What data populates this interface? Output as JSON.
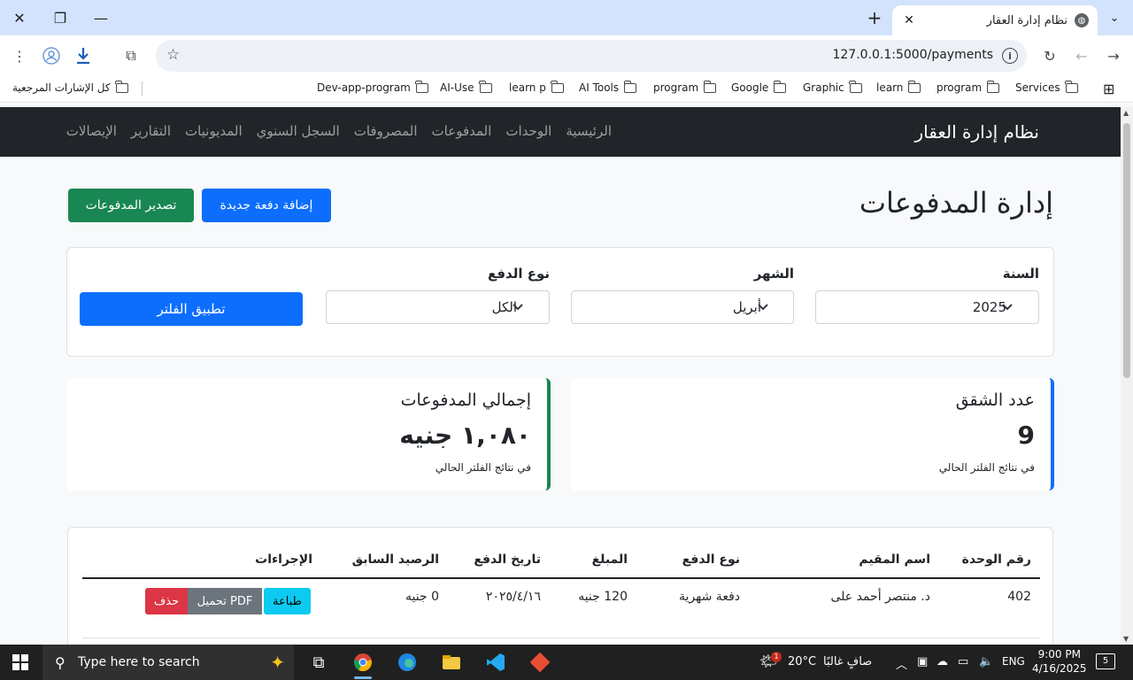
{
  "browser": {
    "tab_title": "نظام إدارة العقار",
    "url": "127.0.0.1:5000/payments",
    "bookmarks": [
      {
        "label": "Services"
      },
      {
        "label": "program"
      },
      {
        "label": "learn"
      },
      {
        "label": "Graphic"
      },
      {
        "label": "Google"
      },
      {
        "label": "program"
      },
      {
        "label": "AI Tools"
      },
      {
        "label": "learn p"
      },
      {
        "label": "AI-Use"
      },
      {
        "label": "Dev-app-program"
      }
    ],
    "all_bookmarks": "كل الإشارات المرجعية"
  },
  "navbar": {
    "brand": "نظام إدارة العقار",
    "links": [
      "الرئيسية",
      "الوحدات",
      "المدفوعات",
      "المصروفات",
      "السجل السنوي",
      "المديونيات",
      "التقارير",
      "الإيصالات"
    ]
  },
  "page": {
    "title": "إدارة المدفوعات",
    "add_button": "إضافة دفعة جديدة",
    "export_button": "تصدير المدفوعات"
  },
  "filters": {
    "year_label": "السنة",
    "year_value": "2025",
    "month_label": "الشهر",
    "month_value": "أبريل",
    "type_label": "نوع الدفع",
    "type_value": "الكل",
    "apply_button": "تطبيق الفلتر"
  },
  "stats": {
    "apartments_title": "عدد الشقق",
    "apartments_value": "9",
    "apartments_note": "في نتائج الفلتر الحالي",
    "total_title": "إجمالي المدفوعات",
    "total_value": "١,٠٨٠ جنيه",
    "total_note": "في نتائج الفلتر الحالي",
    "apartments_color": "#0d6efd",
    "total_color": "#198754"
  },
  "table": {
    "headers": [
      "رقم الوحدة",
      "اسم المقيم",
      "نوع الدفع",
      "المبلغ",
      "تاريخ الدفع",
      "الرصيد السابق",
      "الإجراءات"
    ],
    "rows": [
      {
        "unit": "402",
        "resident": "د. منتصر أحمد على",
        "type": "دفعة شهرية",
        "amount": "120 جنيه",
        "date": "٢٠٢٥/٤/١٦",
        "prev_balance": "0 جنيه",
        "actions": {
          "print": "طباعة",
          "pdf": "تحميل PDF",
          "delete": "حذف"
        }
      }
    ]
  },
  "taskbar": {
    "search_placeholder": "Type here to search",
    "weather_temp": "20°C",
    "weather_desc": "صافٍ غالبًا",
    "language": "ENG",
    "time": "9:00 PM",
    "date": "4/16/2025",
    "notifications": "5",
    "weather_badge": "1"
  }
}
